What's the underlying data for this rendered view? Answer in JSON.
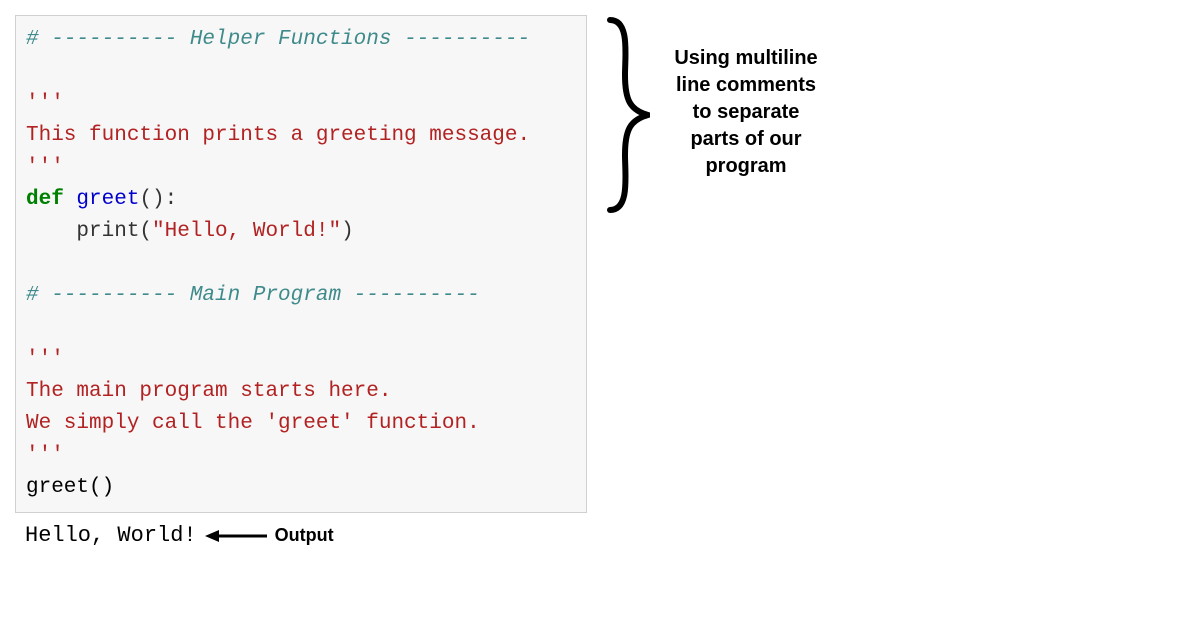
{
  "code": {
    "section1_hash": "# ---------- ",
    "section1_title": "Helper Functions",
    "section1_tail": " ----------",
    "doc1_open": "'''",
    "doc1_body": "This function prints a greeting message.",
    "doc1_close": "'''",
    "def_kw": "def",
    "def_sp": " ",
    "fn_name": "greet",
    "fn_sig_tail": "():",
    "indent": "    ",
    "print_call_head": "print(",
    "print_str": "\"Hello, World!\"",
    "print_call_tail": ")",
    "section2_hash": "# ---------- ",
    "section2_title": "Main Program",
    "section2_tail": " ----------",
    "doc2_open": "'''",
    "doc2_line1": "The main program starts here.",
    "doc2_line2": "We simply call the 'greet' function.",
    "doc2_close": "'''",
    "call_line": "greet()"
  },
  "output": {
    "text": "Hello, World!",
    "label": "Output"
  },
  "annotation": {
    "text": "Using multiline line comments to separate parts of our program"
  }
}
